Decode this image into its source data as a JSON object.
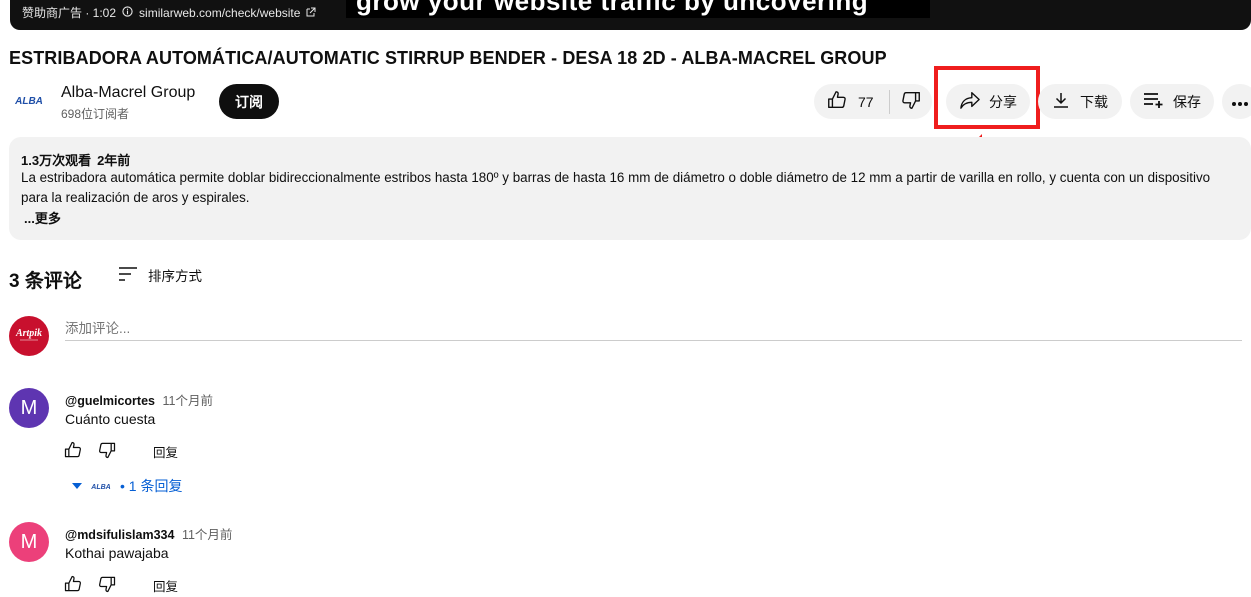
{
  "ad": {
    "label": "赞助商广告 · 1:02",
    "info_icon": "info-icon",
    "url": "similarweb.com/check/website",
    "external_icon": "external-link-icon",
    "headline": "grow your website traffic by uncovering"
  },
  "video": {
    "title": "ESTRIBADORA AUTOMÁTICA/AUTOMATIC STIRRUP BENDER - DESA 18 2D - ALBA-MACREL GROUP"
  },
  "channel": {
    "logo_text": "ALBA",
    "name": "Alba-Macrel Group",
    "subscribers": "698位订阅者",
    "subscribe_label": "订阅"
  },
  "actions": {
    "like_count": "77",
    "share_label": "分享",
    "download_label": "下载",
    "save_label": "保存"
  },
  "description": {
    "views": "1.3万次观看",
    "age": "2年前",
    "text": "La estribadora automática permite doblar bidireccionalmente estribos hasta 180º y barras de hasta 16 mm de diámetro o doble diámetro de 12 mm a partir de varilla en rollo, y cuenta con un dispositivo para la realización de aros y espirales.",
    "more": "...更多"
  },
  "comments": {
    "count_label": "3 条评论",
    "sort_label": "排序方式",
    "add_placeholder": "添加评论...",
    "my_avatar_text": "Artpik",
    "reply_label": "回复",
    "items": [
      {
        "avatar_letter": "M",
        "avatar_color": "#5e35b1",
        "author": "@guelmicortes",
        "time": "11个月前",
        "text": "Cuánto cuesta",
        "replies": "• 1 条回复"
      },
      {
        "avatar_letter": "M",
        "avatar_color": "#ec407a",
        "author": "@mdsifulislam334",
        "time": "11个月前",
        "text": "Kothai pawajaba"
      }
    ]
  },
  "colors": {
    "highlight": "#ef1d1d",
    "link": "#065fd4",
    "subscribe_bg": "#0f0f0f"
  }
}
